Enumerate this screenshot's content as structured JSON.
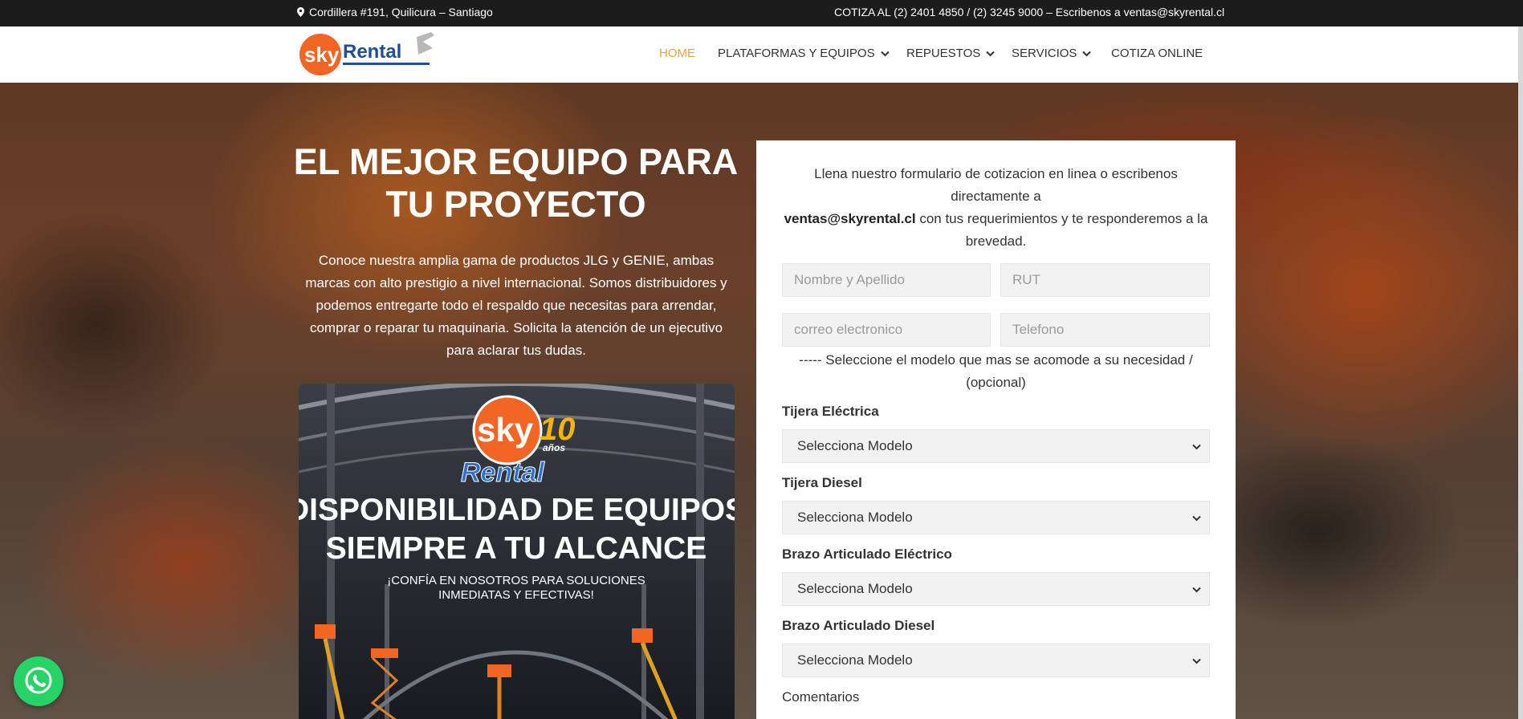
{
  "topbar": {
    "address": "Cordillera #191, Quilicura – Santiago",
    "contact": "COTIZA AL (2) 2401 4850 / (2) 3245 9000 – Escribenos a ventas@skyrental.cl"
  },
  "logo": {
    "brand_text": "Rental"
  },
  "nav": {
    "items": [
      "HOME",
      "PLATAFORMAS Y EQUIPOS",
      "REPUESTOS",
      "SERVICIOS",
      "COTIZA ONLINE"
    ]
  },
  "hero": {
    "title": "EL MEJOR EQUIPO PARA TU PROYECTO",
    "text": "Conoce nuestra amplia gama de productos JLG y GENIE, ambas marcas con alto prestigio a nivel internacional. Somos distribuidores y podemos entregarte todo el respaldo que necesitas para arrendar, comprar o reparar tu maquinaria. Solicita la atención de un ejecutivo para aclarar tus dudas."
  },
  "promo": {
    "logo_text": "sky",
    "anniversary": "10",
    "anniversary_sub": "años",
    "logo_sub": "Rental",
    "headline_1": "DISPONIBILIDAD DE EQUIPOS",
    "headline_2": "SIEMPRE A TU ALCANCE",
    "subline_1": "¡CONFÍA EN NOSOTROS PARA SOLUCIONES",
    "subline_2": "INMEDIATAS Y EFECTIVAS!"
  },
  "form": {
    "lead_1": "Llena nuestro formulario de cotizacion en linea o escribenos directamente a",
    "lead_email": "ventas@skyrental.cl",
    "lead_2": " con tus requerimientos y te responderemos a la brevedad.",
    "placeholders": {
      "name": "Nombre y Apellido",
      "rut": "RUT",
      "email": "correo electronico",
      "phone": "Telefono"
    },
    "model_note": "----- Seleccione el modelo que mas se acomode a su necesidad / (opcional)",
    "groups": [
      {
        "label": "Tijera Eléctrica",
        "value": "Selecciona Modelo"
      },
      {
        "label": "Tijera Diesel",
        "value": "Selecciona Modelo"
      },
      {
        "label": "Brazo Articulado Eléctrico",
        "value": "Selecciona Modelo"
      },
      {
        "label": "Brazo Articulado Diesel",
        "value": "Selecciona Modelo"
      }
    ],
    "comments_label": "Comentarios"
  },
  "colors": {
    "accent": "#f0a030",
    "topbar": "#1c1c1c",
    "whatsapp": "#25d366",
    "promo_orange": "#f26522",
    "promo_blue": "#1d4f9c"
  },
  "icons": {
    "pin": "map-pin-icon",
    "chevron": "chevron-down-icon",
    "whatsapp": "whatsapp-icon"
  }
}
